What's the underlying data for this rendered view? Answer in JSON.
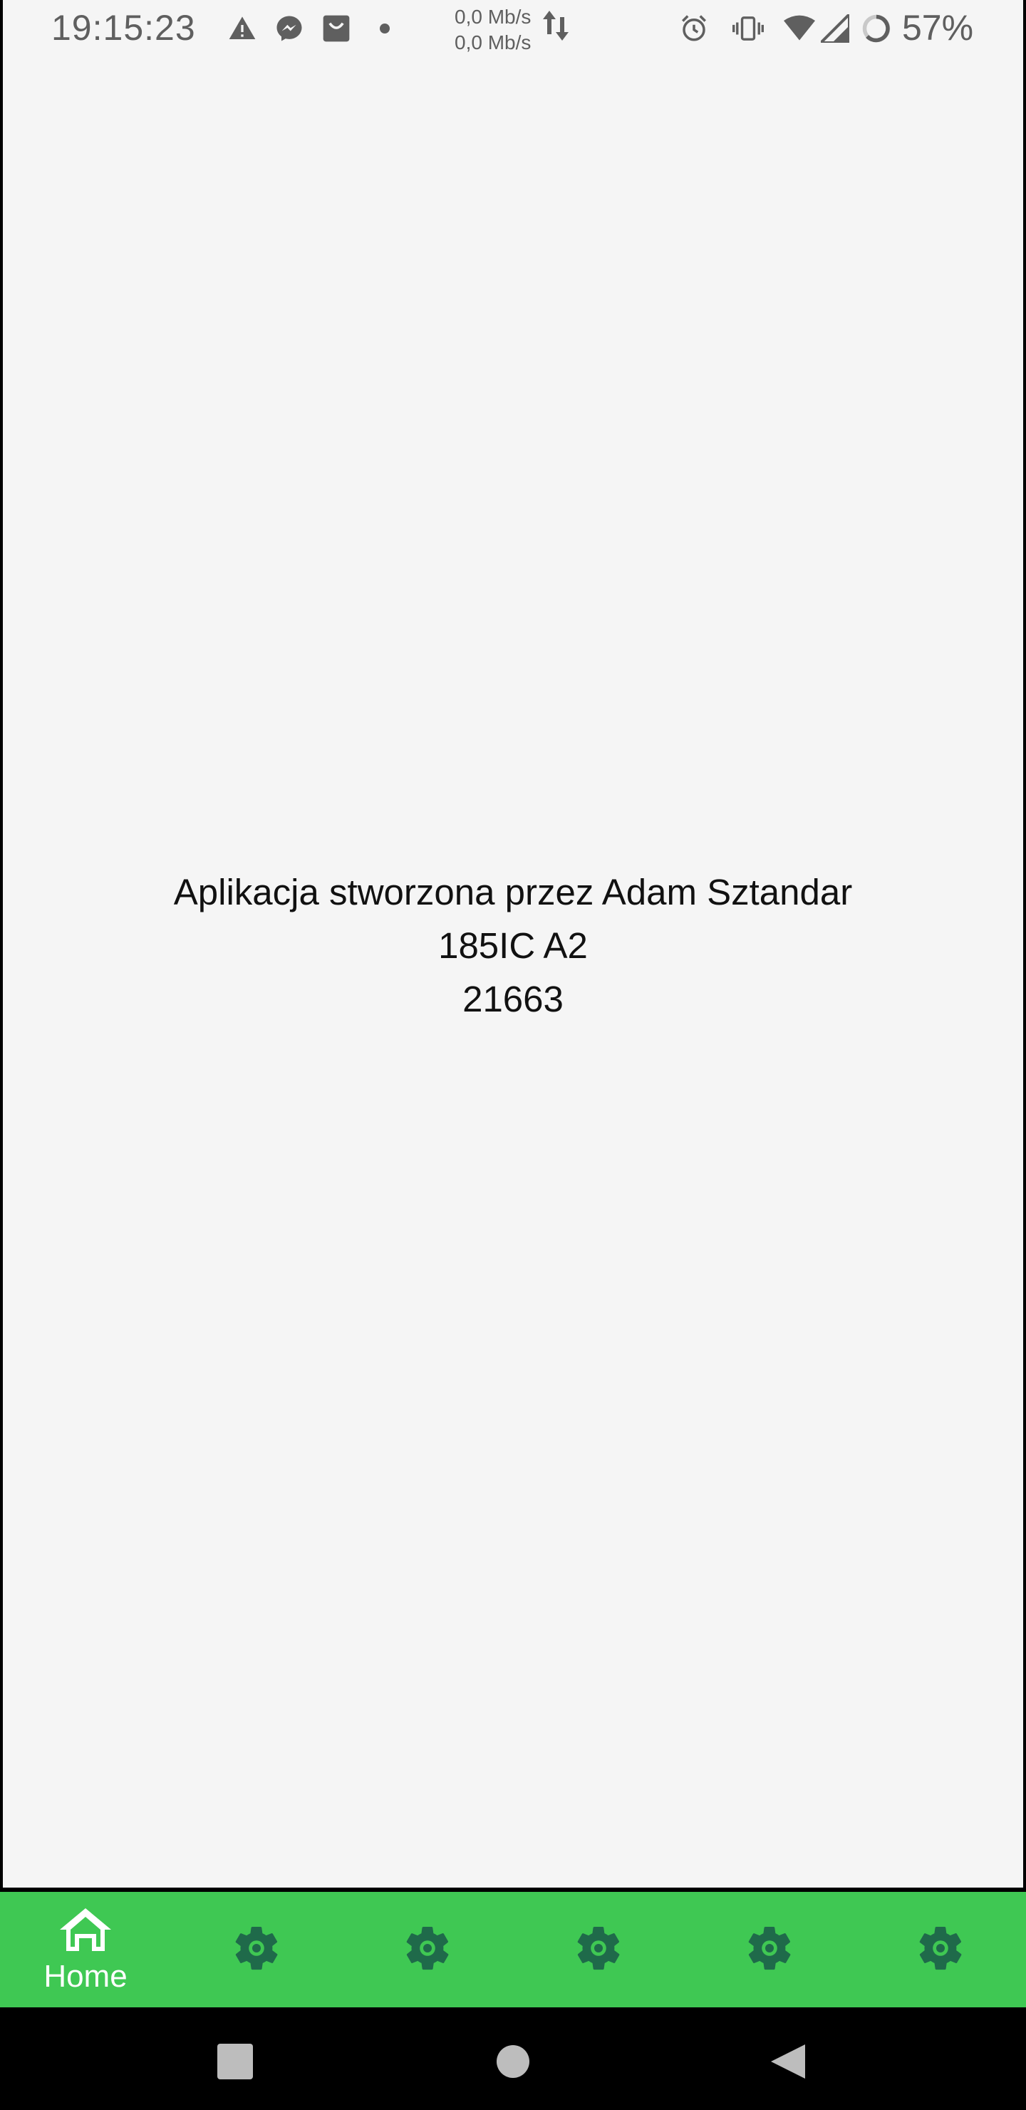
{
  "status_bar": {
    "time": "19:15:23",
    "net_speed_up": "0,0 Mb/s",
    "net_speed_down": "0,0 Mb/s",
    "battery": "57%",
    "icons": [
      "warning-icon",
      "messenger-icon",
      "shopping-bag-icon",
      "dot-icon",
      "data-transfer-icon",
      "alarm-icon",
      "vibrate-icon",
      "wifi-icon",
      "cell-signal-icon",
      "battery-ring-icon"
    ]
  },
  "main": {
    "line1": "Aplikacja stworzona przez Adam Sztandar",
    "line2": "185IC A2",
    "line3": "21663"
  },
  "bottom_nav": {
    "items": [
      {
        "label": "Home",
        "icon": "home-icon",
        "active": true
      },
      {
        "label": "",
        "icon": "gear-icon",
        "active": false
      },
      {
        "label": "",
        "icon": "gear-icon",
        "active": false
      },
      {
        "label": "",
        "icon": "gear-icon",
        "active": false
      },
      {
        "label": "",
        "icon": "gear-icon",
        "active": false
      },
      {
        "label": "",
        "icon": "gear-icon",
        "active": false
      }
    ],
    "colors": {
      "background": "#3fc853",
      "icon_inactive": "#1f6a4a",
      "icon_active": "#ffffff"
    }
  },
  "system_nav": {
    "buttons": [
      "recents-square-icon",
      "home-circle-icon",
      "back-triangle-icon"
    ],
    "color": "#bdbdbd"
  }
}
